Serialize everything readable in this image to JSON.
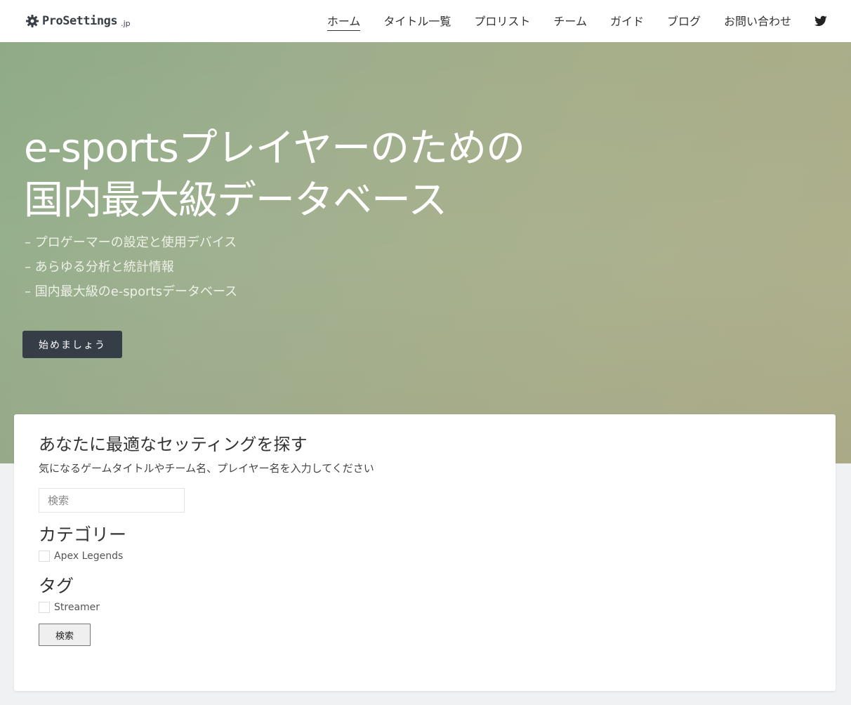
{
  "header": {
    "logo_text": "ProSettings",
    "logo_suffix": ".jp",
    "nav": [
      {
        "label": "ホーム",
        "active": true
      },
      {
        "label": "タイトル一覧"
      },
      {
        "label": "プロリスト"
      },
      {
        "label": "チーム"
      },
      {
        "label": "ガイド"
      },
      {
        "label": "ブログ"
      },
      {
        "label": "お問い合わせ"
      }
    ],
    "social_icon": "twitter-icon"
  },
  "hero": {
    "title_line1": "e-sportsプレイヤーのための",
    "title_line2": "国内最大級データベース",
    "subs": [
      "– プロゲーマーの設定と使用デバイス",
      "– あらゆる分析と統計情報",
      "– 国内最大級のe-sportsデータベース"
    ],
    "cta_label": "始めましょう"
  },
  "search": {
    "title": "あなたに最適なセッティングを探す",
    "description": "気になるゲームタイトルやチーム名、プレイヤー名を入力してください",
    "placeholder": "検索",
    "category_heading": "カテゴリー",
    "category_option": "Apex Legends",
    "tag_heading": "タグ",
    "tag_option": "Streamer",
    "submit_label": "検索"
  },
  "colors": {
    "header_bg": "#ffffff",
    "hero_start": "#8fab86",
    "hero_end": "#adad88",
    "cta_bg": "#353d47",
    "page_bg": "#f0f1f3"
  }
}
